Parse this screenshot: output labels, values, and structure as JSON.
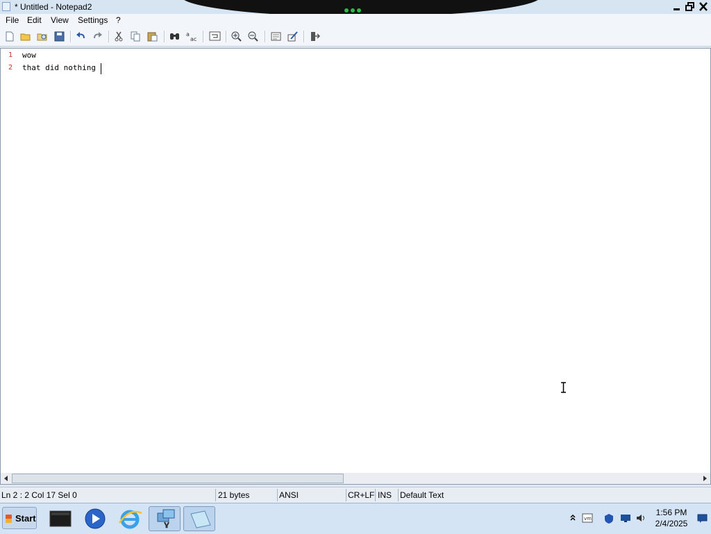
{
  "window": {
    "title": "* Untitled - Notepad2"
  },
  "menu": [
    "File",
    "Edit",
    "View",
    "Settings",
    "?"
  ],
  "toolbar_icons": [
    "new-icon",
    "open-icon",
    "browse-icon",
    "save-icon",
    "undo-icon",
    "redo-icon",
    "cut-icon",
    "copy-icon",
    "paste-icon",
    "find-icon",
    "replace-icon",
    "word-wrap-icon",
    "zoom-in-icon",
    "zoom-out-icon",
    "scheme-icon",
    "customize-scheme-icon",
    "exit-icon"
  ],
  "editor": {
    "lines": [
      {
        "number": "1",
        "text": "wow"
      },
      {
        "number": "2",
        "text": "that did nothing"
      }
    ]
  },
  "status": {
    "position": "Ln 2 : 2   Col 17   Sel 0",
    "size": "21 bytes",
    "encoding": "ANSI",
    "eol": "CR+LF",
    "mode": "INS",
    "scheme": "Default Text"
  },
  "taskbar": {
    "start_label": "Start",
    "apps": [
      "terminal-icon",
      "media-player-icon",
      "internet-explorer-icon",
      "remote-desktop-icon",
      "notepad2-icon"
    ],
    "clock_time": "1:56 PM",
    "clock_date": "2/4/2025"
  },
  "colors": {
    "line_number": "#c4302b",
    "title_bar": "#d7e4f2",
    "taskbar": "#d5e4f5"
  }
}
